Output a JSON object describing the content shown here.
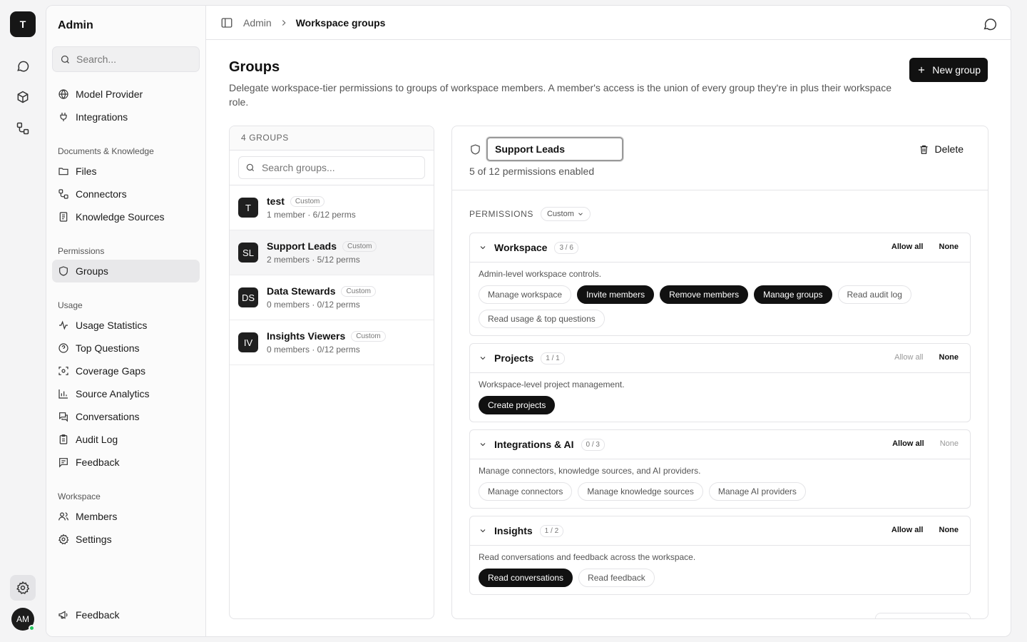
{
  "rail": {
    "logo": "T",
    "avatar": "AM"
  },
  "sidebar": {
    "title": "Admin",
    "search_placeholder": "Search...",
    "top_items": [
      {
        "label": "Model Provider",
        "icon": "globe-icon"
      },
      {
        "label": "Integrations",
        "icon": "plug-icon"
      }
    ],
    "sections": [
      {
        "title": "Documents & Knowledge",
        "items": [
          {
            "label": "Files",
            "icon": "folder-icon"
          },
          {
            "label": "Connectors",
            "icon": "connector-icon"
          },
          {
            "label": "Knowledge Sources",
            "icon": "book-icon"
          }
        ]
      },
      {
        "title": "Permissions",
        "items": [
          {
            "label": "Groups",
            "icon": "shield-icon"
          }
        ]
      },
      {
        "title": "Usage",
        "items": [
          {
            "label": "Usage Statistics",
            "icon": "activity-icon"
          },
          {
            "label": "Top Questions",
            "icon": "question-icon"
          },
          {
            "label": "Coverage Gaps",
            "icon": "scan-icon"
          },
          {
            "label": "Source Analytics",
            "icon": "bar-chart-icon"
          },
          {
            "label": "Conversations",
            "icon": "chat-icon"
          },
          {
            "label": "Audit Log",
            "icon": "clipboard-icon"
          },
          {
            "label": "Feedback",
            "icon": "message-square-icon"
          }
        ]
      },
      {
        "title": "Workspace",
        "items": [
          {
            "label": "Members",
            "icon": "users-icon"
          },
          {
            "label": "Settings",
            "icon": "gear-icon"
          }
        ]
      }
    ],
    "footer_feedback": "Feedback"
  },
  "topbar": {
    "crumb_parent": "Admin",
    "crumb_current": "Workspace groups"
  },
  "page": {
    "title": "Groups",
    "description": "Delegate workspace-tier permissions to groups of workspace members. A member's access is the union of every group they're in plus their workspace role.",
    "new_button": "New group"
  },
  "groups_list": {
    "header": "4 GROUPS",
    "search_placeholder": "Search groups...",
    "groups": [
      {
        "initials": "T",
        "name": "test",
        "tag": "Custom",
        "meta": "1 member · 6/12 perms"
      },
      {
        "initials": "SL",
        "name": "Support Leads",
        "tag": "Custom",
        "meta": "2 members · 5/12 perms"
      },
      {
        "initials": "DS",
        "name": "Data Stewards",
        "tag": "Custom",
        "meta": "0 members · 0/12 perms"
      },
      {
        "initials": "IV",
        "name": "Insights Viewers",
        "tag": "Custom",
        "meta": "0 members · 0/12 perms"
      }
    ]
  },
  "detail": {
    "name": "Support Leads",
    "summary": "5 of 12 permissions enabled",
    "delete_label": "Delete",
    "permissions_label": "PERMISSIONS",
    "preset": "Custom",
    "allow_all": "Allow all",
    "none": "None",
    "categories": [
      {
        "title": "Workspace",
        "count": "3 / 6",
        "description": "Admin-level workspace controls.",
        "allow_all_enabled": true,
        "none_enabled": true,
        "permissions": [
          {
            "label": "Manage workspace",
            "enabled": false
          },
          {
            "label": "Invite members",
            "enabled": true
          },
          {
            "label": "Remove members",
            "enabled": true
          },
          {
            "label": "Manage groups",
            "enabled": true
          },
          {
            "label": "Read audit log",
            "enabled": false
          },
          {
            "label": "Read usage & top questions",
            "enabled": false
          }
        ]
      },
      {
        "title": "Projects",
        "count": "1 / 1",
        "description": "Workspace-level project management.",
        "allow_all_enabled": false,
        "none_enabled": true,
        "permissions": [
          {
            "label": "Create projects",
            "enabled": true
          }
        ]
      },
      {
        "title": "Integrations & AI",
        "count": "0 / 3",
        "description": "Manage connectors, knowledge sources, and AI providers.",
        "allow_all_enabled": true,
        "none_enabled": false,
        "permissions": [
          {
            "label": "Manage connectors",
            "enabled": false
          },
          {
            "label": "Manage knowledge sources",
            "enabled": false
          },
          {
            "label": "Manage AI providers",
            "enabled": false
          }
        ]
      },
      {
        "title": "Insights",
        "count": "1 / 2",
        "description": "Read conversations and feedback across the workspace.",
        "allow_all_enabled": true,
        "none_enabled": true,
        "permissions": [
          {
            "label": "Read conversations",
            "enabled": true
          },
          {
            "label": "Read feedback",
            "enabled": false
          }
        ]
      }
    ]
  }
}
